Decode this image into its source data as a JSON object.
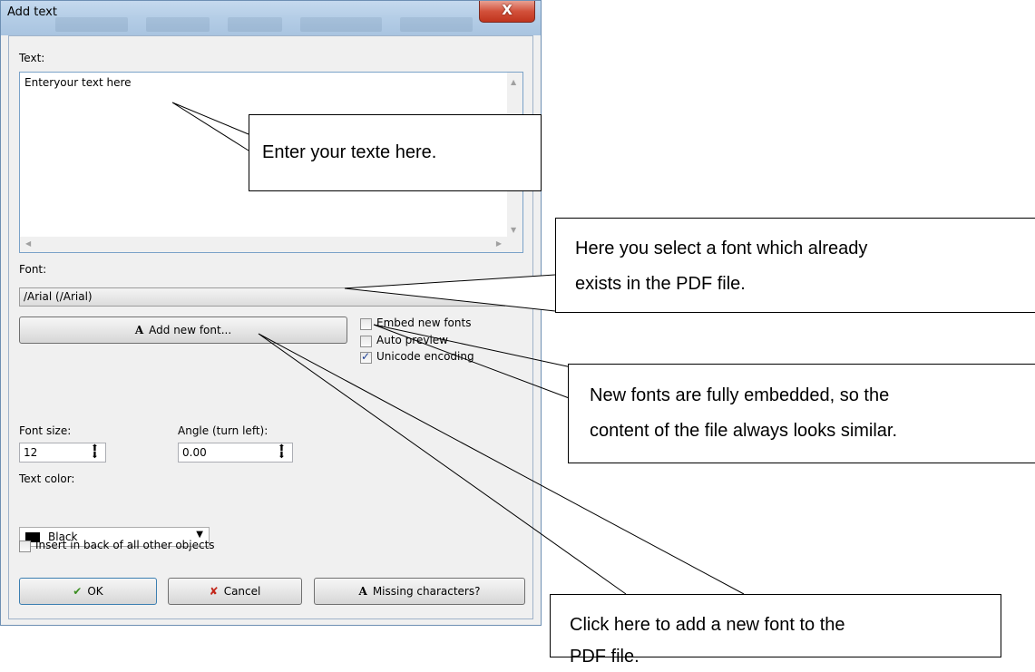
{
  "window": {
    "title": "Add text",
    "close_glyph": "X"
  },
  "text_section": {
    "label": "Text:",
    "value": "Enteryour text here"
  },
  "font_section": {
    "label": "Font:",
    "selected_font": "/Arial (/Arial)",
    "add_font_button": "Add new font...",
    "add_font_glyph": "A"
  },
  "options": {
    "embed_new_fonts": {
      "label": "Embed new fonts",
      "checked": false
    },
    "auto_preview": {
      "label": "Auto preview",
      "checked": false
    },
    "unicode_encoding": {
      "label": "Unicode encoding",
      "checked": true
    }
  },
  "font_size": {
    "label": "Font size:",
    "value": "12"
  },
  "angle": {
    "label": "Angle (turn left):",
    "value": "0.00"
  },
  "text_color": {
    "label": "Text color:",
    "value": "Black",
    "swatch": "#000000"
  },
  "insert_back": {
    "label": "Insert in back of all other objects",
    "checked": false
  },
  "buttons": {
    "ok": "OK",
    "cancel": "Cancel",
    "missing": "Missing characters?",
    "missing_glyph": "A",
    "ok_glyph": "✔",
    "cancel_glyph": "✘"
  },
  "callouts": {
    "enter_text": "Enter your texte here.",
    "select_font_1": "Here you select a font which already",
    "select_font_2": "exists in the PDF file.",
    "embedded_1": "New fonts are fully embedded, so the",
    "embedded_2": "content of the file always looks similar.",
    "add_font_1": "Click here to add a new font to the",
    "add_font_2": "PDF file."
  }
}
